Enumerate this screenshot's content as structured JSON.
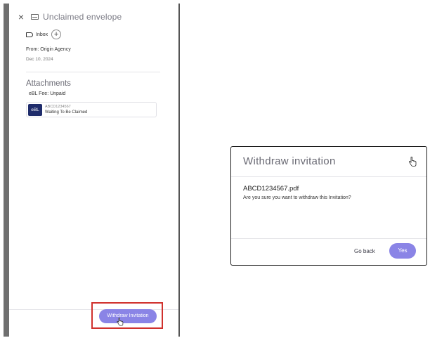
{
  "panel": {
    "title": "Unclaimed envelope",
    "tag_label": "Inbox",
    "add_symbol": "+",
    "from": "From: Origin Agency",
    "date": "Dec 10, 2024",
    "attachments_title": "Attachments",
    "fee": "eBL Fee: Unpaid",
    "document": {
      "badge": "eBL",
      "id": "ABCD1234567",
      "status": "Waiting To Be Claimed"
    },
    "withdraw_button": "Withdraw Invitation",
    "close_symbol": "×"
  },
  "dialog": {
    "title": "Withdraw invitation",
    "file_name": "ABCD1234567.pdf",
    "message": "Are you sure you want to withdraw this Invitation?",
    "go_back": "Go back",
    "yes": "Yes"
  },
  "colors": {
    "accent": "#8a84e6",
    "ebl_badge": "#1f2c6b",
    "highlight": "#d0312d"
  },
  "icons": [
    "close-icon",
    "envelope-icon",
    "tag-icon",
    "plus-icon",
    "pointer-cursor-icon"
  ]
}
